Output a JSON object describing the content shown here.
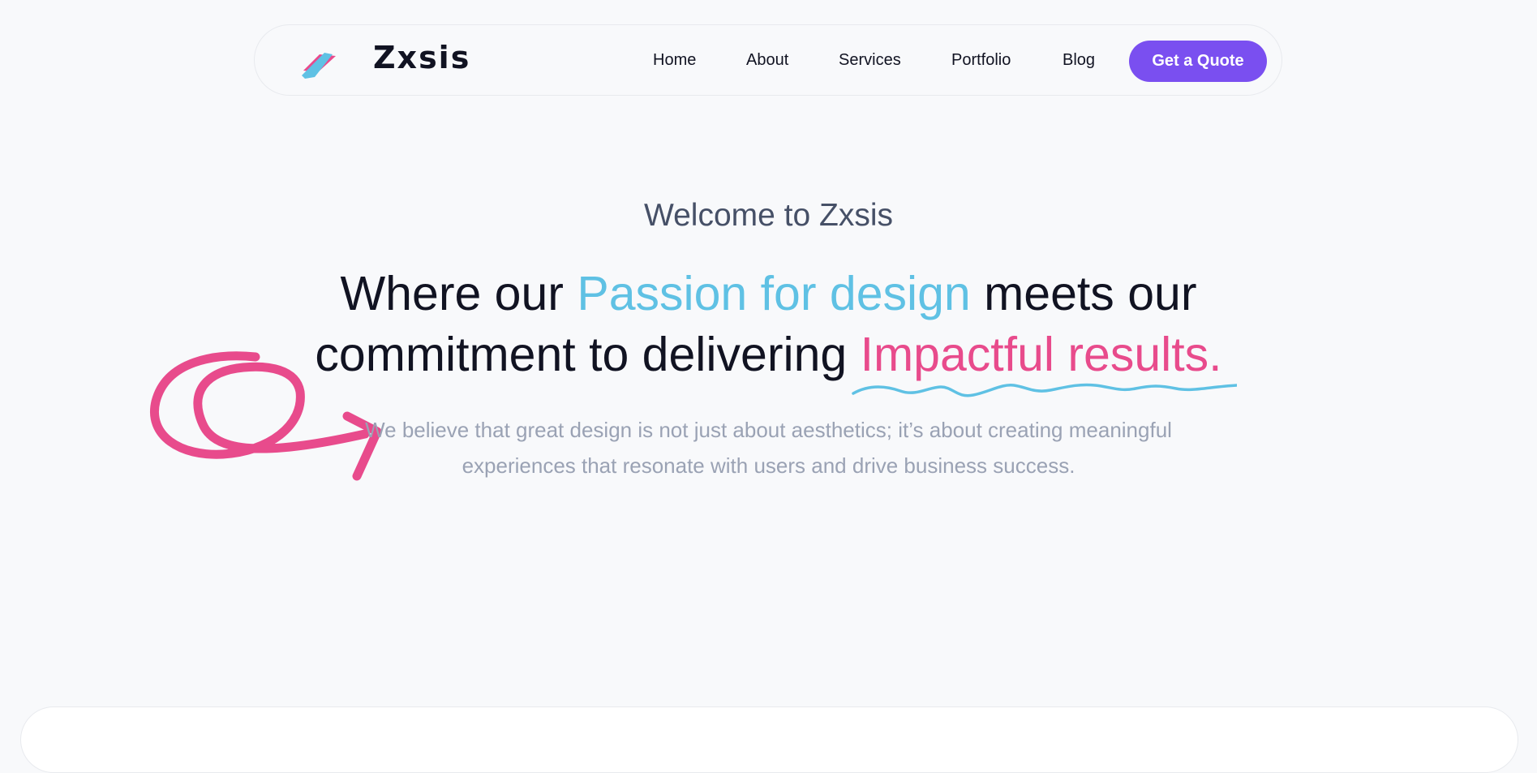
{
  "header": {
    "brand": "Zxsis",
    "nav": [
      "Home",
      "About",
      "Services",
      "Portfolio",
      "Blog"
    ],
    "cta_label": "Get a Quote"
  },
  "hero": {
    "welcome": "Welcome to Zxsis",
    "headline": {
      "part1": "Where our ",
      "highlight1": "Passion for design",
      "part2": " meets our commitment to delivering ",
      "highlight2": "Impactful results."
    },
    "description": "We believe that great design is not just about aesthetics; it’s about creating meaningful experiences that resonate with users and drive business success."
  },
  "colors": {
    "accent_purple": "#7a4ff0",
    "accent_blue": "#5fc1e4",
    "accent_pink": "#e84b8c",
    "text_dark": "#111322",
    "text_muted": "#9aa2b4"
  },
  "icons": [
    "logo-icon",
    "swirl-arrow-icon",
    "squiggle-underline-icon"
  ]
}
